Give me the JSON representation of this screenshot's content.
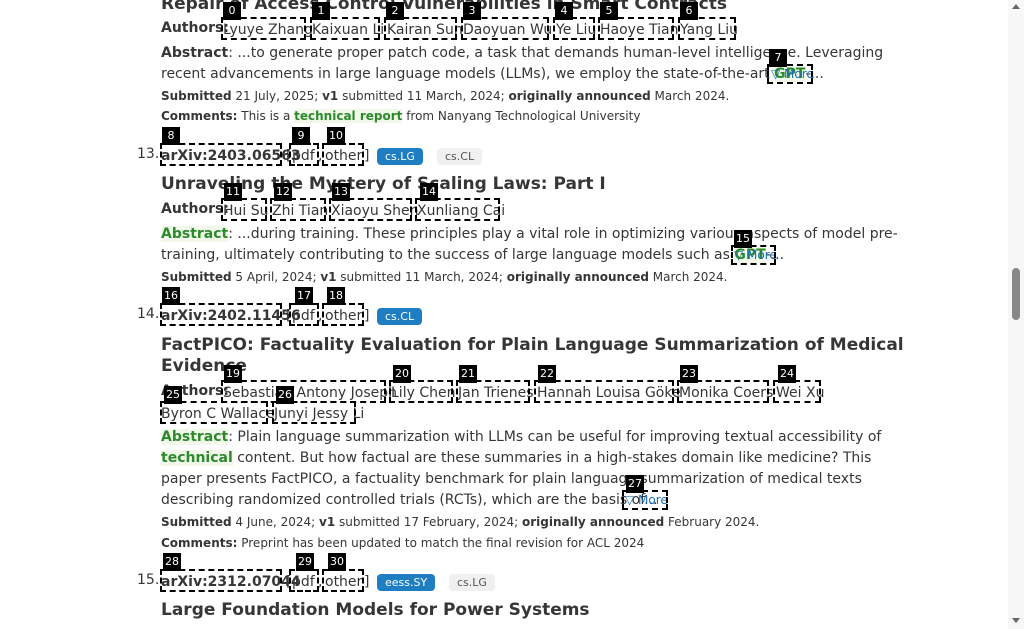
{
  "entries": [
    {
      "title": "Repair of Access Control Vulnerabilities in Smart Contracts",
      "authors_label": "Authors:",
      "authors": [
        "Lyuye Zhang",
        "Kaixuan Li",
        "Kairan Sun",
        "Daoyuan Wu",
        "Ye Liu",
        "Haoye Tian",
        "Yang Liu"
      ],
      "abstract_label": "Abstract",
      "abstract_line1": ": ...to generate proper patch code, a task that demands human-level intelligence. Leveraging",
      "abstract_line2_pre": "recent advancements in large language models (LLMs), we employ the state-of-the-art ",
      "abstract_line2_hl": "GPT",
      "abstract_line2_post": "-...",
      "more": "▽ More",
      "submitted_label": "Submitted",
      "submitted": " 21 July, 2025; ",
      "v1": "v1",
      "v1_text": " submitted 11 March, 2024; ",
      "orig_label": "originally announced",
      "orig": " March 2024.",
      "comments_label": "Comments:",
      "comments_pre": " This is a ",
      "comments_hl": "technical report",
      "comments_post": " from Nanyang Technological University"
    },
    {
      "number": "13.",
      "arxiv": "arXiv:2403.06563",
      "pdf": "pdf",
      "other": "other",
      "tags": [
        "cs.LG",
        "cs.CL"
      ],
      "title": "Unraveling the Mystery of Scaling Laws: Part I",
      "authors_label": "Authors:",
      "authors": [
        "Hui Su",
        "Zhi Tian",
        "Xiaoyu Shen",
        "Xunliang Cai"
      ],
      "abstract_label": "Abstract",
      "abstract_line1": ": ...during training. These principles play a vital role in optimizing various aspects of model pre-",
      "abstract_line2_pre": "training, ultimately contributing to the success of large language models such as ",
      "abstract_line2_hl": "GPT",
      "abstract_line2_post": "-...",
      "more": "▽ More",
      "submitted_label": "Submitted",
      "submitted": " 5 April, 2024; ",
      "v1": "v1",
      "v1_text": " submitted 11 March, 2024; ",
      "orig_label": "originally announced",
      "orig": " March 2024."
    },
    {
      "number": "14.",
      "arxiv": "arXiv:2402.11456",
      "pdf": "pdf",
      "other": "other",
      "tags": [
        "cs.CL"
      ],
      "title_line1": "FactPICO: Factuality Evaluation for Plain Language Summarization of Medical",
      "title_line2": "Evidence",
      "authors_label": "Authors:",
      "authors": [
        "Sebastian Antony Joseph",
        "Lily Chen",
        "Jan Trienes",
        "Hannah Louisa Göke",
        "Monika Coers",
        "Wei Xu",
        "Byron C Wallace",
        "Junyi Jessy Li"
      ],
      "abstract_label": "Abstract",
      "abstract_line1": ": Plain language summarization with LLMs can be useful for improving textual accessibility of",
      "abstract_line2_hl": "technical",
      "abstract_line2_post": " content. But how factual are these summaries in a high-stakes domain like medicine? This",
      "abstract_line3": "paper presents FactPICO, a factuality benchmark for plain language summarization of medical texts",
      "abstract_line4": "describing randomized controlled trials (RCTs), which are the basis of...",
      "more": "▽ More",
      "submitted_label": "Submitted",
      "submitted": " 4 June, 2024; ",
      "v1": "v1",
      "v1_text": " submitted 17 February, 2024; ",
      "orig_label": "originally announced",
      "orig": " February 2024.",
      "comments_label": "Comments:",
      "comments_text": " Preprint has been updated to match the final revision for ACL 2024"
    },
    {
      "number": "15.",
      "arxiv": "arXiv:2312.07044",
      "pdf": "pdf",
      "other": "other",
      "tags": [
        "eess.SY",
        "cs.LG"
      ],
      "title": "Large Foundation Models for Power Systems"
    }
  ],
  "bracket_open": "[",
  "bracket_close": "]",
  "comma": ",",
  "badges": [
    "0",
    "1",
    "2",
    "3",
    "4",
    "5",
    "6",
    "7",
    "8",
    "9",
    "10",
    "11",
    "12",
    "13",
    "14",
    "15",
    "16",
    "17",
    "18",
    "19",
    "20",
    "21",
    "22",
    "23",
    "24",
    "25",
    "26",
    "27",
    "28",
    "29",
    "30"
  ]
}
